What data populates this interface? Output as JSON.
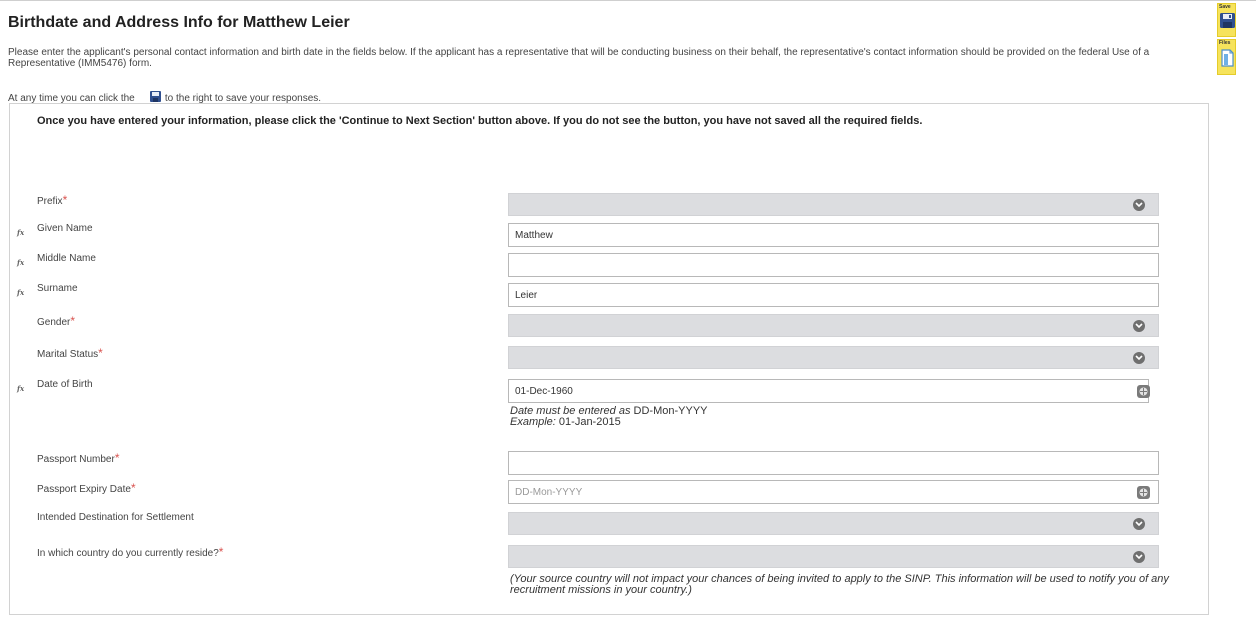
{
  "page": {
    "title": "Birthdate and Address Info for Matthew Leier",
    "intro": "Please enter the applicant's personal contact information and birth date in the fields below. If the applicant has a representative that will be conducting business on their behalf, the representative's contact information should be provided on the federal Use of a Representative (IMM5476) form.",
    "save_hint_before": "At any time you can click the",
    "save_hint_after": "to the right to save your responses."
  },
  "toolbar": {
    "save_label": "Save",
    "files_label": "Files",
    "accent": "#f6e35c"
  },
  "form": {
    "notice": "Once you have entered your information, please click the 'Continue to Next Section' button above. If you do not see the button, you have not saved all the required fields.",
    "required_mark": "*",
    "required_color": "#d9534f",
    "fx_icon": "fx",
    "fields": {
      "prefix": {
        "label": "Prefix",
        "value": ""
      },
      "given_name": {
        "label": "Given Name",
        "value": "Matthew"
      },
      "middle_name": {
        "label": "Middle Name",
        "value": ""
      },
      "surname": {
        "label": "Surname",
        "value": "Leier"
      },
      "gender": {
        "label": "Gender",
        "value": ""
      },
      "marital_status": {
        "label": "Marital Status",
        "value": ""
      },
      "date_of_birth": {
        "label": "Date of Birth",
        "value": "01-Dec-1960",
        "helper_prefix": "Date must be entered as",
        "helper_format": "DD-Mon-YYYY",
        "example_prefix": "Example:",
        "example_value": "01-Jan-2015"
      },
      "passport_number": {
        "label": "Passport Number",
        "value": ""
      },
      "passport_expiry": {
        "label": "Passport Expiry Date",
        "value": "",
        "placeholder": "DD-Mon-YYYY"
      },
      "intended_destination": {
        "label": "Intended Destination for Settlement",
        "value": ""
      },
      "country_of_residence": {
        "label": "In which country do you currently reside?",
        "value": "",
        "helper": "(Your source country will not impact your chances of being invited to apply to the SINP. This information will be used to notify you of any recruitment missions in your country.)"
      }
    }
  }
}
